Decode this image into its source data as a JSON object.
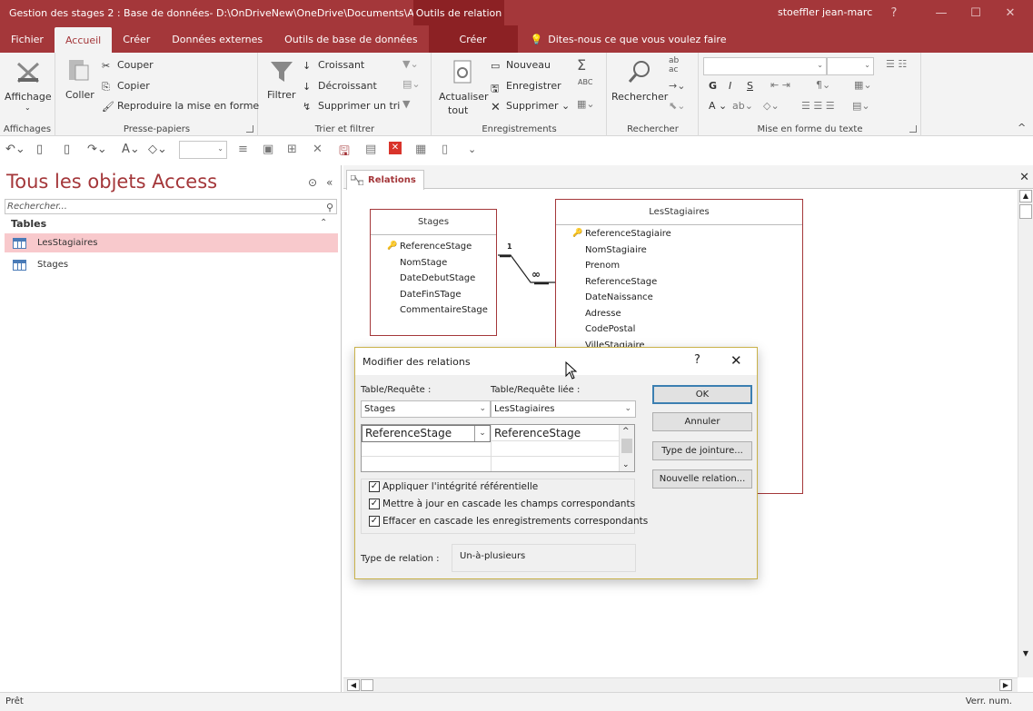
{
  "window": {
    "title": "Gestion des stages 2 : Base de données- D:\\OnDriveNew\\OneDrive\\Documents\\A...",
    "context_title": "Outils de relation",
    "user": "stoeffler jean-marc",
    "help": "?"
  },
  "tabs": [
    "Fichier",
    "Accueil",
    "Créer",
    "Données externes",
    "Outils de base de données",
    "Créer"
  ],
  "tell_me": "Dites-nous ce que vous voulez faire",
  "ribbon": {
    "affichages": {
      "label": "Affichages",
      "btn": "Affichage"
    },
    "presse": {
      "label": "Presse-papiers",
      "coller": "Coller",
      "couper": "Couper",
      "copier": "Copier",
      "reproduire": "Reproduire la mise en forme"
    },
    "trier": {
      "label": "Trier et filtrer",
      "filtrer": "Filtrer",
      "croissant": "Croissant",
      "decroissant": "Décroissant",
      "supprimer_tri": "Supprimer un tri"
    },
    "enreg": {
      "label": "Enregistrements",
      "actualiser1": "Actualiser",
      "actualiser2": "tout",
      "nouveau": "Nouveau",
      "enregistrer": "Enregistrer",
      "supprimer": "Supprimer"
    },
    "rechercher": {
      "label": "Rechercher",
      "btn": "Rechercher"
    },
    "miseforme": {
      "label": "Mise en forme du texte",
      "g": "G",
      "i": "I",
      "s": "S",
      "a": "A"
    }
  },
  "nav": {
    "title": "Tous les objets Access",
    "search_placeholder": "Rechercher...",
    "section": "Tables",
    "items": [
      "LesStagiaires",
      "Stages"
    ]
  },
  "doc": {
    "tab": "Relations",
    "tables": {
      "stages": {
        "title": "Stages",
        "fields": [
          "ReferenceStage",
          "NomStage",
          "DateDebutStage",
          "DateFinSTage",
          "CommentaireStage"
        ]
      },
      "stagiaires": {
        "title": "LesStagiaires",
        "fields": [
          "ReferenceStagiaire",
          "NomStagiaire",
          "Prenom",
          "ReferenceStage",
          "DateNaissance",
          "Adresse",
          "CodePostal",
          "VilleStagiaire"
        ]
      }
    },
    "rel_one": "1",
    "rel_many": "∞"
  },
  "dialog": {
    "title": "Modifier des relations",
    "help": "?",
    "table_label": "Table/Requête :",
    "linked_label": "Table/Requête liée :",
    "table": "Stages",
    "linked": "LesStagiaires",
    "field1": "ReferenceStage",
    "field2": "ReferenceStage",
    "chk_integrity": "Appliquer l'intégrité référentielle",
    "chk_update": "Mettre à jour en cascade les champs correspondants",
    "chk_delete": "Effacer en cascade les enregistrements correspondants",
    "ok": "OK",
    "cancel": "Annuler",
    "join": "Type de jointure...",
    "new_rel": "Nouvelle relation...",
    "reltype_label": "Type de relation :",
    "reltype": "Un-à-plusieurs"
  },
  "status": {
    "left": "Prêt",
    "right": "Verr. num."
  },
  "colors": {
    "accent": "#a4373a",
    "selected": "#f8c9cc"
  }
}
